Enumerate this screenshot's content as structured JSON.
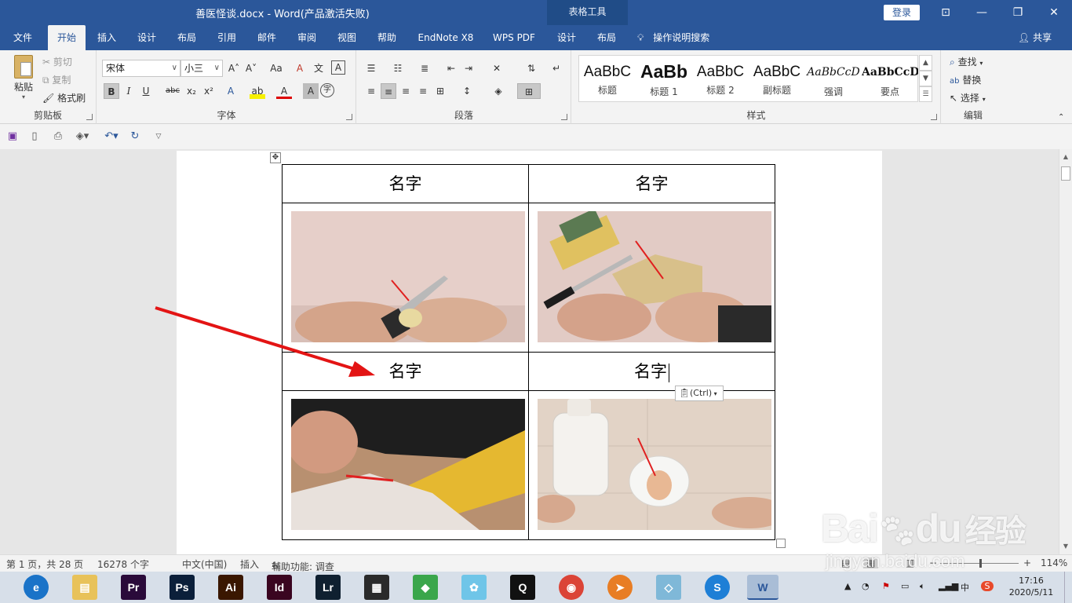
{
  "window": {
    "title": "善医怪谈.docx  -  Word(产品激活失败)",
    "context_tab": "表格工具",
    "login": "登录",
    "controls": {
      "ribbon_display": "⊡",
      "minimize": "—",
      "restore": "❐",
      "close": "✕"
    }
  },
  "tabs": [
    {
      "label": "文件"
    },
    {
      "label": "开始"
    },
    {
      "label": "插入"
    },
    {
      "label": "设计"
    },
    {
      "label": "布局"
    },
    {
      "label": "引用"
    },
    {
      "label": "邮件"
    },
    {
      "label": "审阅"
    },
    {
      "label": "视图"
    },
    {
      "label": "帮助"
    },
    {
      "label": "EndNote X8"
    },
    {
      "label": "WPS PDF"
    },
    {
      "label": "设计"
    },
    {
      "label": "布局"
    }
  ],
  "tell_me": "操作说明搜索",
  "share": "共享",
  "ribbon": {
    "clipboard": {
      "paste": "粘贴",
      "cut": "剪切",
      "copy": "复制",
      "format_painter": "格式刷",
      "label": "剪贴板"
    },
    "font": {
      "name": "宋体",
      "size": "小三",
      "label": "字体",
      "grow": "A˄",
      "shrink": "A˅",
      "case": "Aa",
      "clear": "A",
      "phonetic": "文",
      "border_char": "A",
      "bold": "B",
      "italic": "I",
      "underline": "U",
      "strike": "abc",
      "sub": "x₂",
      "sup": "x²",
      "effects": "A",
      "highlight": "ab",
      "color": "A",
      "shading": "A",
      "enclose": "字"
    },
    "paragraph": {
      "label": "段落"
    },
    "styles": {
      "label": "样式",
      "items": [
        {
          "preview": "AaBbC",
          "name": "标题"
        },
        {
          "preview": "AaBb",
          "name": "标题 1"
        },
        {
          "preview": "AaBbC",
          "name": "标题 2"
        },
        {
          "preview": "AaBbC",
          "name": "副标题"
        },
        {
          "preview": "AaBbCcD",
          "name": "强调"
        },
        {
          "preview": "AaBbCcD",
          "name": "要点"
        }
      ]
    },
    "editing": {
      "find": "查找",
      "replace": "替换",
      "select": "选择",
      "label": "编辑"
    }
  },
  "document": {
    "table": {
      "row1": [
        "名字",
        "名字"
      ],
      "row3": [
        "名字",
        "名字"
      ]
    },
    "paste_options": "(Ctrl)"
  },
  "status": {
    "page": "第 1 页，共 28 页",
    "words": "16278 个字",
    "language": "中文(中国)",
    "mode": "插入",
    "accessibility": "辅助功能: 调查",
    "zoom_minus": "−",
    "zoom_plus": "+",
    "zoom": "114%"
  },
  "taskbar": {
    "apps": [
      {
        "label": "e",
        "color": "#1a73c8"
      },
      {
        "label": "▤",
        "color": "#e8c25a"
      },
      {
        "label": "Pr",
        "color": "#2a0a3a"
      },
      {
        "label": "Ps",
        "color": "#0b1f3a"
      },
      {
        "label": "Ai",
        "color": "#3a1700"
      },
      {
        "label": "Id",
        "color": "#3a0520"
      },
      {
        "label": "Lr",
        "color": "#0f2030"
      },
      {
        "label": "▦",
        "color": "#2a2a2a"
      },
      {
        "label": "◆",
        "color": "#3aa64b"
      },
      {
        "label": "✿",
        "color": "#6fc5e8"
      },
      {
        "label": "Q",
        "color": "#111111"
      },
      {
        "label": "◉",
        "color": "#db4437"
      },
      {
        "label": "➤",
        "color": "#e87d24"
      },
      {
        "label": "◇",
        "color": "#7fb8d8"
      },
      {
        "label": "S",
        "color": "#1e7fd6"
      },
      {
        "label": "W",
        "color": "#2b579a"
      }
    ],
    "ime": "中",
    "time": "17:16",
    "date": "2020/5/11"
  },
  "watermark": {
    "brand": "Bai",
    "brand2": "du",
    "cn": "经验",
    "url": "jingyan.baidu.com"
  }
}
